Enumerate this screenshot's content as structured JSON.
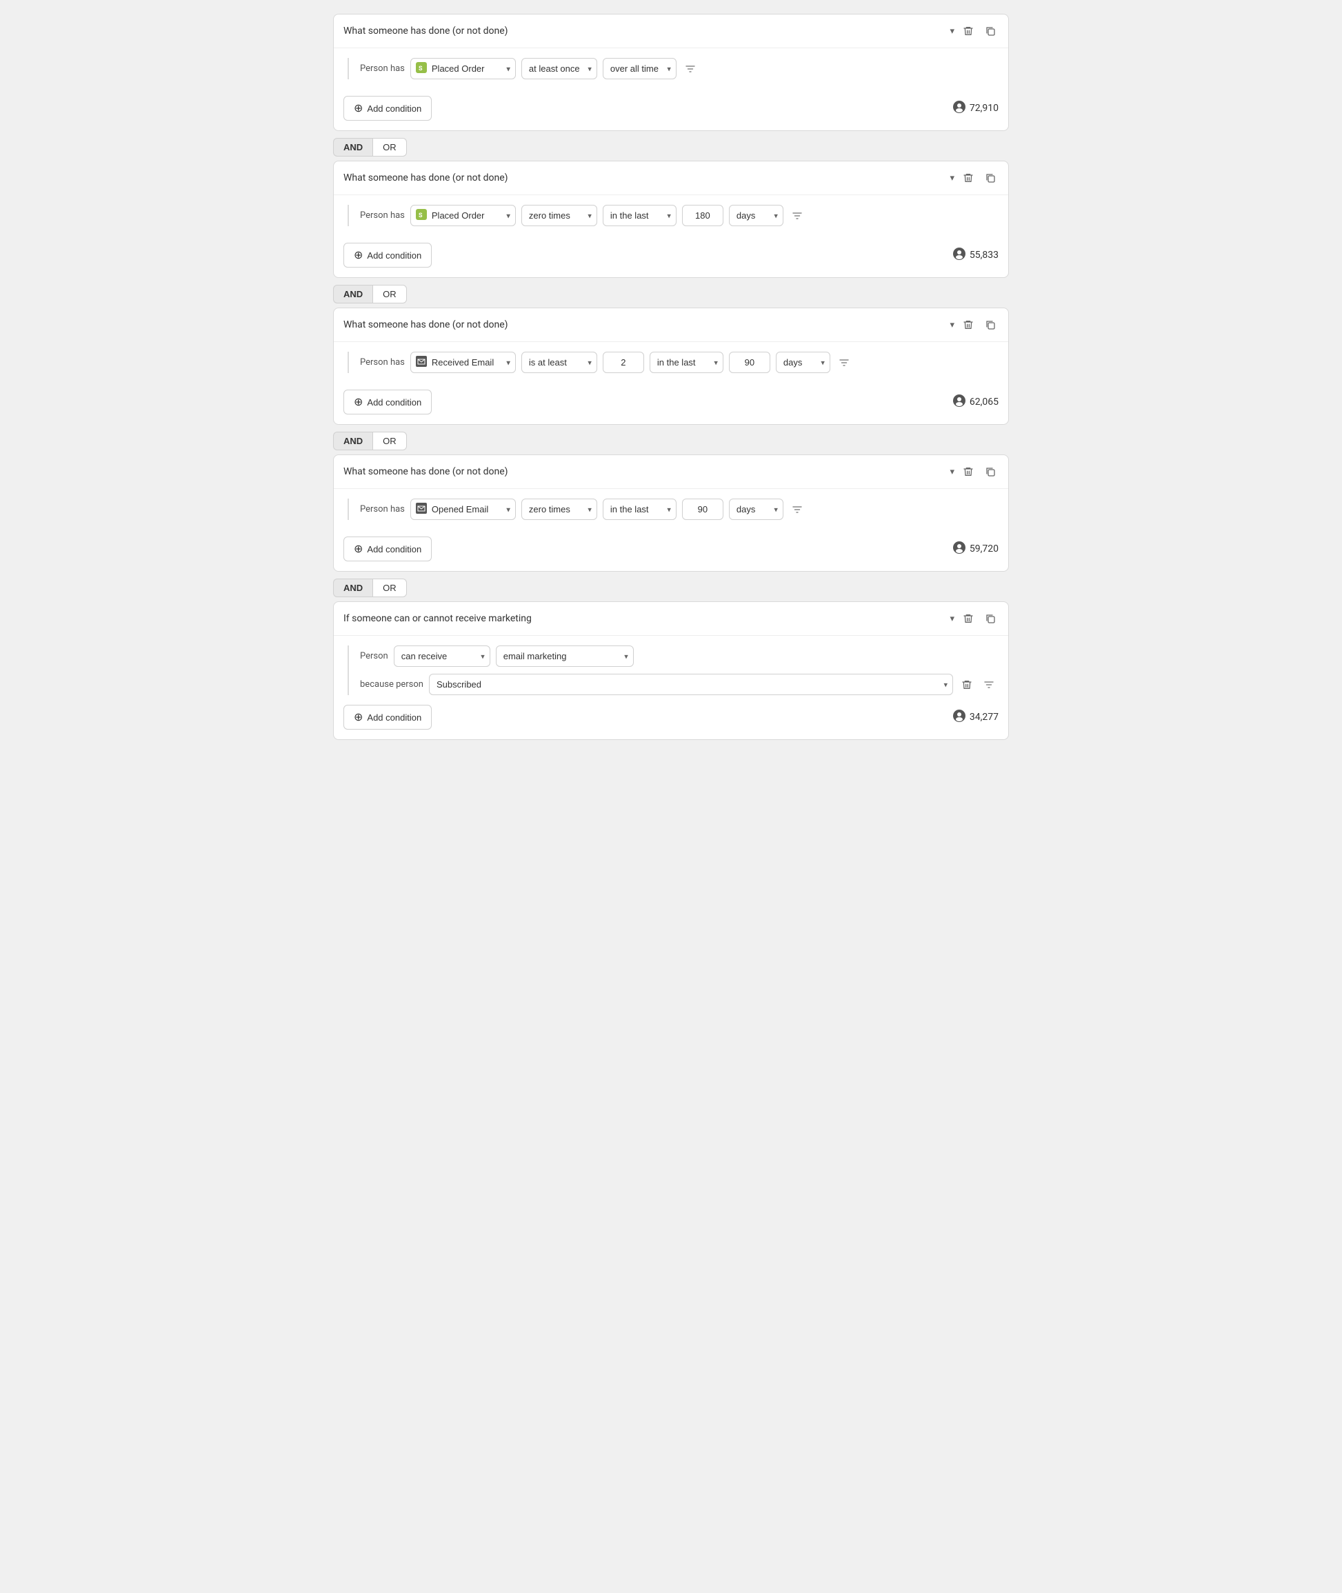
{
  "blocks": [
    {
      "id": "block1",
      "header_label": "What someone has done (or not done)",
      "person_label": "Person has",
      "action": "Placed Order",
      "action_type": "shopify",
      "frequency": "at least once",
      "time_filter": "over all time",
      "show_number_input": false,
      "show_days_input": false,
      "count": "72,910",
      "add_condition_label": "Add condition",
      "logic": {
        "and_label": "AND",
        "or_label": "OR",
        "active": "AND"
      }
    },
    {
      "id": "block2",
      "header_label": "What someone has done (or not done)",
      "person_label": "Person has",
      "action": "Placed Order",
      "action_type": "shopify",
      "frequency": "zero times",
      "time_filter": "in the last",
      "show_number_input": true,
      "number_value": "180",
      "show_days_input": true,
      "days_value": "days",
      "count": "55,833",
      "add_condition_label": "Add condition",
      "logic": {
        "and_label": "AND",
        "or_label": "OR",
        "active": "AND"
      }
    },
    {
      "id": "block3",
      "header_label": "What someone has done (or not done)",
      "person_label": "Person has",
      "action": "Received Email",
      "action_type": "email",
      "frequency": "is at least",
      "show_middle_input": true,
      "middle_value": "2",
      "time_filter": "in the last",
      "show_number_input": true,
      "number_value": "90",
      "show_days_input": true,
      "days_value": "days",
      "count": "62,065",
      "add_condition_label": "Add condition",
      "logic": {
        "and_label": "AND",
        "or_label": "OR",
        "active": "AND"
      }
    },
    {
      "id": "block4",
      "header_label": "What someone has done (or not done)",
      "person_label": "Person has",
      "action": "Opened Email",
      "action_type": "email",
      "frequency": "zero times",
      "time_filter": "in the last",
      "show_number_input": true,
      "number_value": "90",
      "show_days_input": true,
      "days_value": "days",
      "count": "59,720",
      "add_condition_label": "Add condition",
      "logic": {
        "and_label": "AND",
        "or_label": "OR",
        "active": "AND"
      }
    },
    {
      "id": "block5",
      "header_label": "If someone can or cannot receive marketing",
      "person_label": "Person",
      "is_marketing": true,
      "receive_label": "can receive",
      "marketing_label": "email marketing",
      "because_label": "because person",
      "because_value": "Subscribed",
      "count": "34,277",
      "add_condition_label": "Add condition"
    }
  ],
  "icons": {
    "trash": "🗑",
    "copy": "⧉",
    "filter": "⊘",
    "add": "+",
    "person": "👤",
    "chevron_down": "▾"
  }
}
